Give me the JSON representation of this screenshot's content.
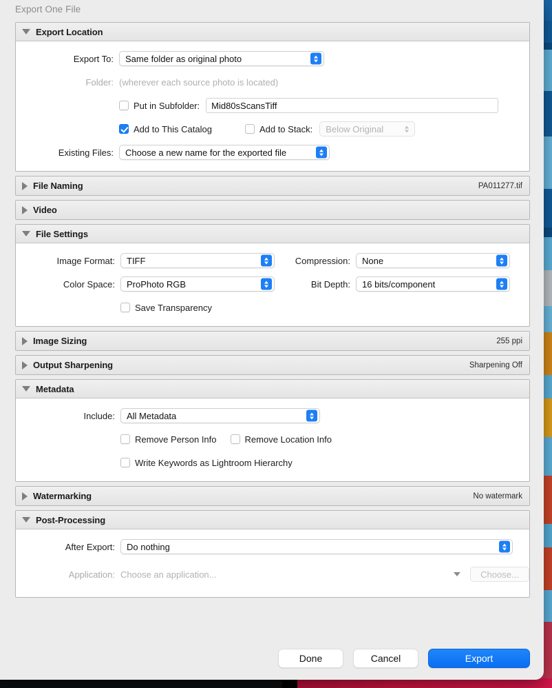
{
  "window": {
    "title": "Export One File"
  },
  "sections": {
    "export_location": {
      "title": "Export Location",
      "expanded": true,
      "export_to_label": "Export To:",
      "export_to_value": "Same folder as original photo",
      "folder_label": "Folder:",
      "folder_value": "(wherever each source photo is located)",
      "put_in_subfolder_label": "Put in Subfolder:",
      "put_in_subfolder_checked": false,
      "subfolder_value": "Mid80sScansTiff",
      "add_to_catalog_label": "Add to This Catalog",
      "add_to_catalog_checked": true,
      "add_to_stack_label": "Add to Stack:",
      "add_to_stack_checked": false,
      "stack_position_value": "Below Original",
      "existing_files_label": "Existing Files:",
      "existing_files_value": "Choose a new name for the exported file"
    },
    "file_naming": {
      "title": "File Naming",
      "expanded": false,
      "summary": "PA011277.tif"
    },
    "video": {
      "title": "Video",
      "expanded": false,
      "summary": ""
    },
    "file_settings": {
      "title": "File Settings",
      "expanded": true,
      "image_format_label": "Image Format:",
      "image_format_value": "TIFF",
      "compression_label": "Compression:",
      "compression_value": "None",
      "color_space_label": "Color Space:",
      "color_space_value": "ProPhoto RGB",
      "bit_depth_label": "Bit Depth:",
      "bit_depth_value": "16 bits/component",
      "save_transparency_label": "Save Transparency",
      "save_transparency_checked": false
    },
    "image_sizing": {
      "title": "Image Sizing",
      "expanded": false,
      "summary": "255 ppi"
    },
    "output_sharpening": {
      "title": "Output Sharpening",
      "expanded": false,
      "summary": "Sharpening Off"
    },
    "metadata": {
      "title": "Metadata",
      "expanded": true,
      "include_label": "Include:",
      "include_value": "All Metadata",
      "remove_person_label": "Remove Person Info",
      "remove_person_checked": false,
      "remove_location_label": "Remove Location Info",
      "remove_location_checked": false,
      "write_keywords_label": "Write Keywords as Lightroom Hierarchy",
      "write_keywords_checked": false
    },
    "watermarking": {
      "title": "Watermarking",
      "expanded": false,
      "summary": "No watermark"
    },
    "post_processing": {
      "title": "Post-Processing",
      "expanded": true,
      "after_export_label": "After Export:",
      "after_export_value": "Do nothing",
      "application_label": "Application:",
      "application_placeholder": "Choose an application...",
      "choose_button_label": "Choose..."
    }
  },
  "footer": {
    "done_label": "Done",
    "cancel_label": "Cancel",
    "export_label": "Export"
  },
  "colors": {
    "accent_blue": "#1d7ff6",
    "primary_button": "#0a6ef0",
    "dialog_background": "#ececec",
    "panel_background": "#ffffff",
    "header_gradient_top": "#f0f0f0",
    "disabled_text": "#b2b2b2"
  }
}
